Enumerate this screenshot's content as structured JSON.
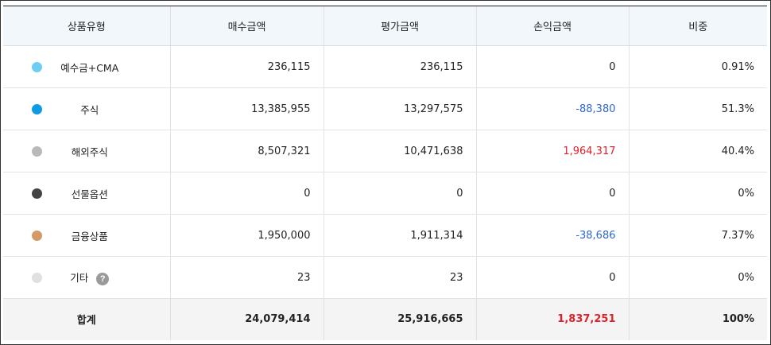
{
  "columns": [
    "상품유형",
    "매수금액",
    "평가금액",
    "손익금액",
    "비중"
  ],
  "rows": [
    {
      "type": "예수금+CMA",
      "dot_color": "#6fcdf3",
      "purchase": "236,115",
      "valuation": "236,115",
      "profit": "0",
      "profit_sign": "zero",
      "weight": "0.91%"
    },
    {
      "type": "주식",
      "dot_color": "#0f9ae6",
      "purchase": "13,385,955",
      "valuation": "13,297,575",
      "profit": "-88,380",
      "profit_sign": "neg",
      "weight": "51.3%"
    },
    {
      "type": "해외주식",
      "dot_color": "#b9b9b9",
      "purchase": "8,507,321",
      "valuation": "10,471,638",
      "profit": "1,964,317",
      "profit_sign": "pos",
      "weight": "40.4%"
    },
    {
      "type": "선물옵션",
      "dot_color": "#444444",
      "purchase": "0",
      "valuation": "0",
      "profit": "0",
      "profit_sign": "zero",
      "weight": "0%"
    },
    {
      "type": "금융상품",
      "dot_color": "#d19a66",
      "purchase": "1,950,000",
      "valuation": "1,911,314",
      "profit": "-38,686",
      "profit_sign": "neg",
      "weight": "7.37%"
    },
    {
      "type": "기타",
      "dot_color": "#e0e0e0",
      "purchase": "23",
      "valuation": "23",
      "profit": "0",
      "profit_sign": "zero",
      "weight": "0%",
      "help_icon": "?"
    }
  ],
  "total": {
    "label": "합계",
    "purchase": "24,079,414",
    "valuation": "25,916,665",
    "profit": "1,837,251",
    "profit_sign": "pos",
    "weight": "100%"
  },
  "icons": {
    "help": "question-mark-icon",
    "dot": "color-dot-icon"
  },
  "colors": {
    "negative": "#2f66d6",
    "positive": "#e0202a",
    "header_bg": "#f2f7fb",
    "total_bg": "#f4f4f4"
  }
}
